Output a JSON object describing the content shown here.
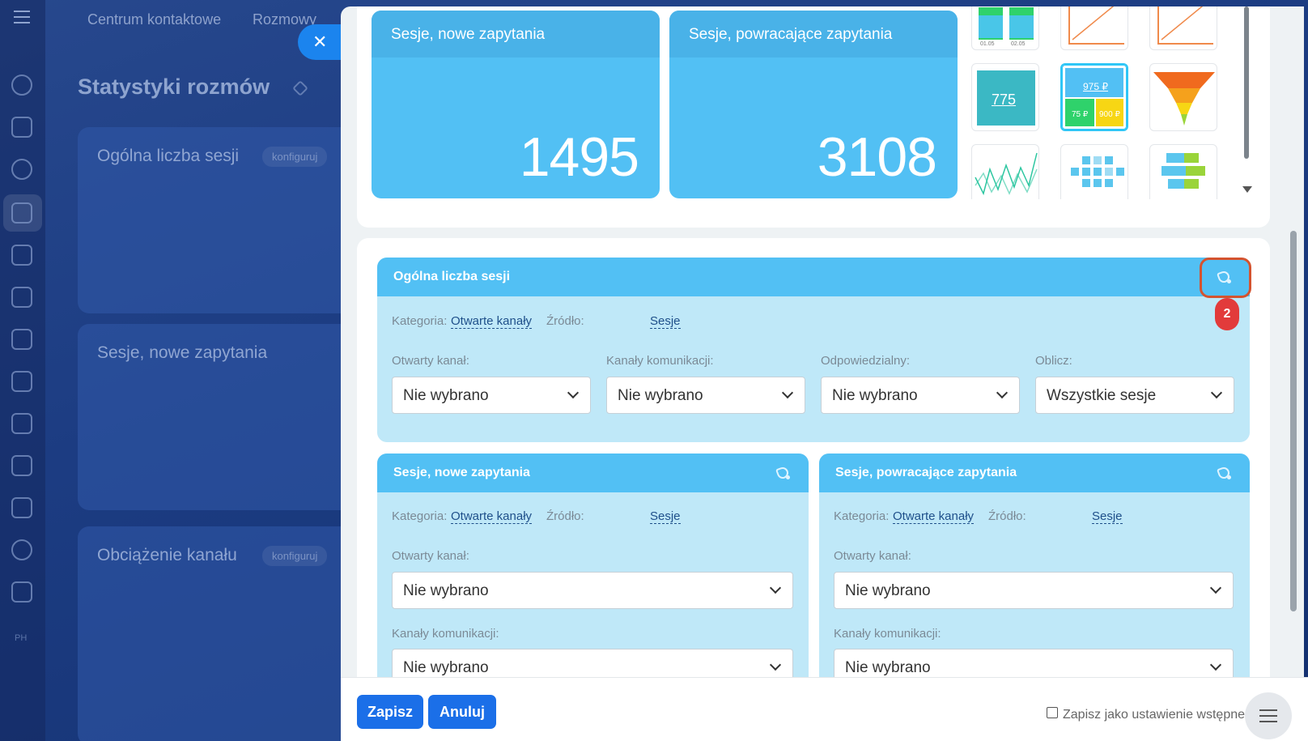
{
  "top_nav": {
    "items": [
      "Centrum kontaktowe",
      "Rozmowy"
    ]
  },
  "page": {
    "title": "Statystyki rozmów"
  },
  "background_cards": [
    {
      "title": "Ogólna liczba sesji",
      "action": "konfiguruj"
    },
    {
      "title": "Sesje, nowe zapytania"
    },
    {
      "title": "Obciążenie kanału",
      "action": "konfiguruj"
    }
  ],
  "sidebar": {
    "footer_text": "PH"
  },
  "close_button": {
    "label": "✕"
  },
  "preview": {
    "kpis": [
      {
        "title": "Sesje, nowe zapytania",
        "value": "1495"
      },
      {
        "title": "Sesje, powracające zapytania",
        "value": "3108"
      }
    ],
    "thumbnails": {
      "dates": [
        "01.05",
        "02.05"
      ],
      "number_tile": "775",
      "numbers_tile": [
        "975 ₽",
        "75 ₽",
        "900 ₽"
      ]
    }
  },
  "config": {
    "main_widget": {
      "title": "Ogólna liczba sesji",
      "category_label": "Kategoria:",
      "category_value": "Otwarte kanały",
      "source_label": "Źródło:",
      "source_value": "Sesje",
      "filters": [
        {
          "label": "Otwarty kanał:",
          "value": "Nie wybrano"
        },
        {
          "label": "Kanały komunikacji:",
          "value": "Nie wybrano"
        },
        {
          "label": "Odpowiedzialny:",
          "value": "Nie wybrano"
        },
        {
          "label": "Oblicz:",
          "value": "Wszystkie sesje"
        }
      ]
    },
    "annotation_badge": "2",
    "sub_widgets": [
      {
        "title": "Sesje, nowe zapytania",
        "category_label": "Kategoria:",
        "category_value": "Otwarte kanały",
        "source_label": "Źródło:",
        "source_value": "Sesje",
        "filters": [
          {
            "label": "Otwarty kanał:",
            "value": "Nie wybrano"
          },
          {
            "label": "Kanały komunikacji:",
            "value": "Nie wybrano"
          }
        ]
      },
      {
        "title": "Sesje, powracające zapytania",
        "category_label": "Kategoria:",
        "category_value": "Otwarte kanały",
        "source_label": "Źródło:",
        "source_value": "Sesje",
        "filters": [
          {
            "label": "Otwarty kanał:",
            "value": "Nie wybrano"
          },
          {
            "label": "Kanały komunikacji:",
            "value": "Nie wybrano"
          }
        ]
      }
    ]
  },
  "footer": {
    "save_label": "Zapisz",
    "cancel_label": "Anuluj",
    "preset_label": "Zapisz jako ustawienie wstępne"
  },
  "colors": {
    "widget_header": "#52c0f4",
    "widget_body": "#bfe8f8",
    "primary_button": "#1b6fe8",
    "highlight": "#d4532f",
    "badge": "#e23b3b"
  }
}
